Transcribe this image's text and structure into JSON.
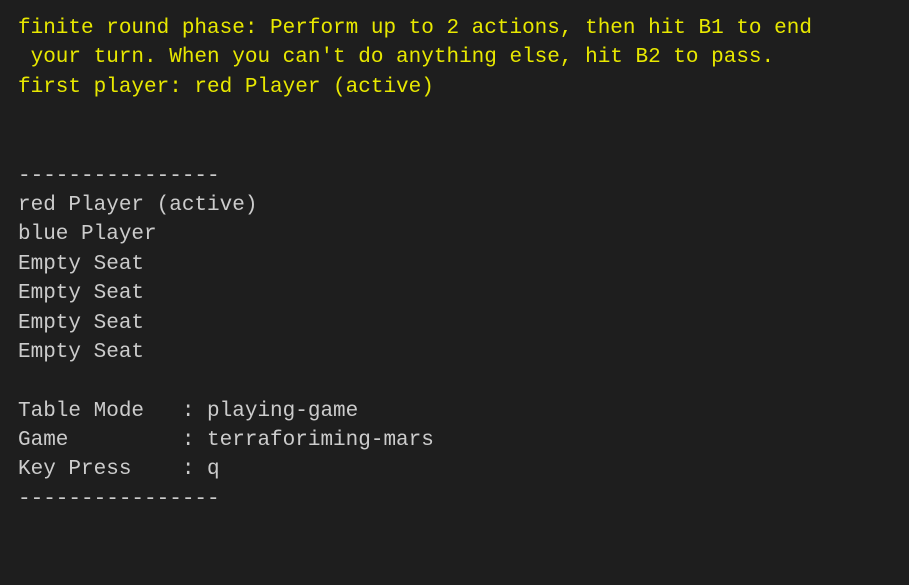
{
  "phase": {
    "line1": "finite round phase: Perform up to 2 actions, then hit B1 to end",
    "line2": " your turn. When you can't do anything else, hit B2 to pass.",
    "first_player": "first player: red Player (active)"
  },
  "separator": "----------------",
  "players": [
    "red Player (active)",
    "blue Player",
    "Empty Seat",
    "Empty Seat",
    "Empty Seat",
    "Empty Seat"
  ],
  "info": {
    "table_mode_label": "Table Mode   : ",
    "table_mode_value": "playing-game",
    "game_label": "Game         : ",
    "game_value": "terraforiming-mars",
    "key_press_label": "Key Press    : ",
    "key_press_value": "q"
  }
}
